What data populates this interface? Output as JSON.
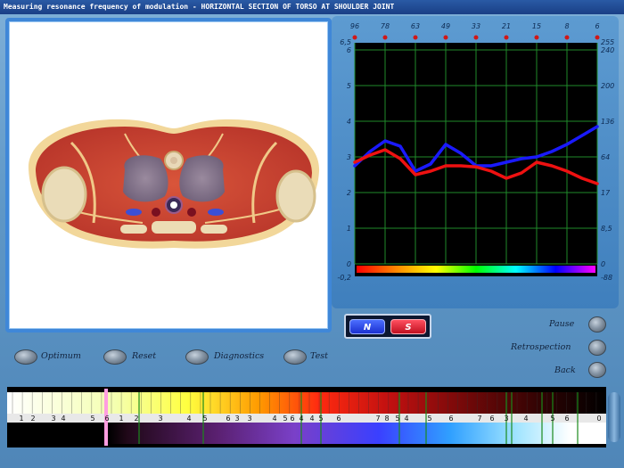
{
  "window": {
    "title": "Measuring resonance frequency of modulation - HORIZONTAL SECTION OF TORSO AT SHOULDER JOINT"
  },
  "chart_data": {
    "type": "line",
    "title": "",
    "ylabel_left": "",
    "ylabel_right": "",
    "y_left_ticks": [
      "6,5",
      "6",
      "5",
      "4",
      "3",
      "2",
      "1",
      "0",
      "-0,2"
    ],
    "y_right_ticks": [
      "255",
      "240",
      "200",
      "136",
      "64",
      "17",
      "8,5",
      "0",
      "-88"
    ],
    "top_ticks": [
      "96",
      "78",
      "63",
      "49",
      "33",
      "21",
      "15",
      "8",
      "6"
    ],
    "ylim_left": [
      0,
      6
    ],
    "grid": true,
    "series": [
      {
        "color": "#1a1aff",
        "values": [
          2.75,
          3.15,
          3.45,
          3.3,
          2.6,
          2.8,
          3.35,
          3.1,
          2.75,
          2.75,
          2.85,
          2.95,
          3.0,
          3.15,
          3.35,
          3.6,
          3.85
        ]
      },
      {
        "color": "#ee1111",
        "values": [
          2.85,
          3.05,
          3.2,
          2.95,
          2.5,
          2.6,
          2.75,
          2.75,
          2.72,
          2.6,
          2.4,
          2.55,
          2.85,
          2.75,
          2.6,
          2.4,
          2.25
        ]
      }
    ],
    "x": [
      0,
      1,
      2,
      3,
      4,
      5,
      6,
      7,
      8,
      9,
      10,
      11,
      12,
      13,
      14,
      15,
      16
    ]
  },
  "controls": {
    "n_label": "N",
    "s_label": "S",
    "optimum": "Optimum",
    "reset": "Reset",
    "diagnostics": "Diagnostics",
    "test": "Test",
    "pause": "Pause",
    "retrospection": "Retrospection",
    "back": "Back"
  },
  "spectrum": {
    "scale_labels": [
      "1",
      "2",
      "3",
      "4",
      "5",
      "6",
      "1",
      "2",
      "3",
      "4",
      "5",
      "6",
      "3",
      "3",
      "4",
      "5",
      "6",
      "4",
      "4",
      "5",
      "6",
      "7",
      "8",
      "5",
      "4",
      "5",
      "6",
      "7",
      "6",
      "3",
      "4",
      "5",
      "6",
      "0"
    ]
  }
}
